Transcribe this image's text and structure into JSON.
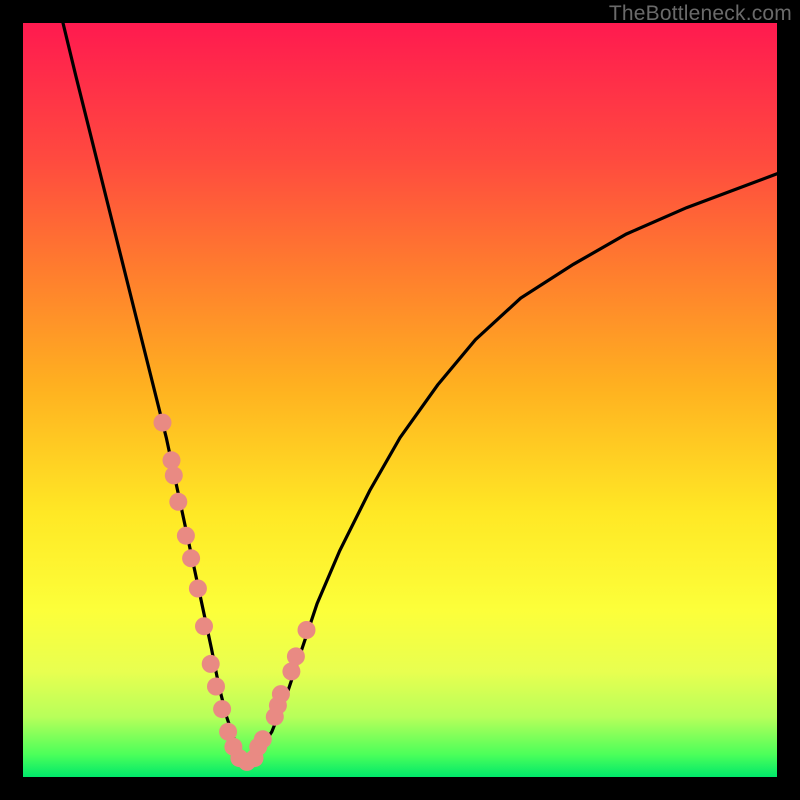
{
  "watermark": "TheBottleneck.com",
  "chart_data": {
    "type": "line",
    "title": "",
    "xlabel": "",
    "ylabel": "",
    "xlim": [
      0,
      100
    ],
    "ylim": [
      0,
      100
    ],
    "series": [
      {
        "name": "curve",
        "x_pct": [
          5.3,
          7.0,
          9.0,
          11.0,
          13.0,
          15.0,
          17.0,
          19.0,
          20.5,
          22.0,
          23.5,
          25.0,
          26.0,
          27.0,
          28.0,
          28.8,
          29.5,
          30.2,
          31.0,
          33.0,
          35.0,
          37.0,
          39.0,
          42.0,
          46.0,
          50.0,
          55.0,
          60.0,
          66.0,
          73.0,
          80.0,
          88.0,
          96.0,
          100.0
        ],
        "y_pct": [
          100.0,
          93.0,
          85.0,
          77.0,
          69.0,
          61.0,
          53.0,
          45.0,
          38.0,
          31.0,
          24.0,
          17.0,
          12.0,
          8.0,
          5.0,
          3.0,
          2.0,
          2.0,
          3.0,
          6.0,
          11.0,
          17.0,
          23.0,
          30.0,
          38.0,
          45.0,
          52.0,
          58.0,
          63.5,
          68.0,
          72.0,
          75.5,
          78.5,
          80.0
        ]
      }
    ],
    "markers": {
      "name": "highlighted-points",
      "color": "#e98a83",
      "radius_px": 9,
      "x_pct": [
        18.5,
        19.7,
        20.0,
        20.6,
        21.6,
        22.3,
        23.2,
        24.0,
        24.9,
        25.6,
        26.4,
        27.2,
        27.9,
        28.7,
        29.7,
        30.7,
        31.2,
        31.8,
        33.4,
        33.8,
        34.2,
        35.6,
        36.2,
        37.6
      ],
      "y_pct": [
        47.0,
        42.0,
        40.0,
        36.5,
        32.0,
        29.0,
        25.0,
        20.0,
        15.0,
        12.0,
        9.0,
        6.0,
        4.0,
        2.5,
        2.0,
        2.5,
        4.0,
        5.0,
        8.0,
        9.5,
        11.0,
        14.0,
        16.0,
        19.5
      ]
    },
    "gradient_stops": [
      {
        "pos": 0.0,
        "color": "#ff1a4f"
      },
      {
        "pos": 0.18,
        "color": "#ff4a3f"
      },
      {
        "pos": 0.48,
        "color": "#ffb020"
      },
      {
        "pos": 0.78,
        "color": "#fcff3a"
      },
      {
        "pos": 0.97,
        "color": "#4cff5a"
      },
      {
        "pos": 1.0,
        "color": "#00e86a"
      }
    ]
  }
}
